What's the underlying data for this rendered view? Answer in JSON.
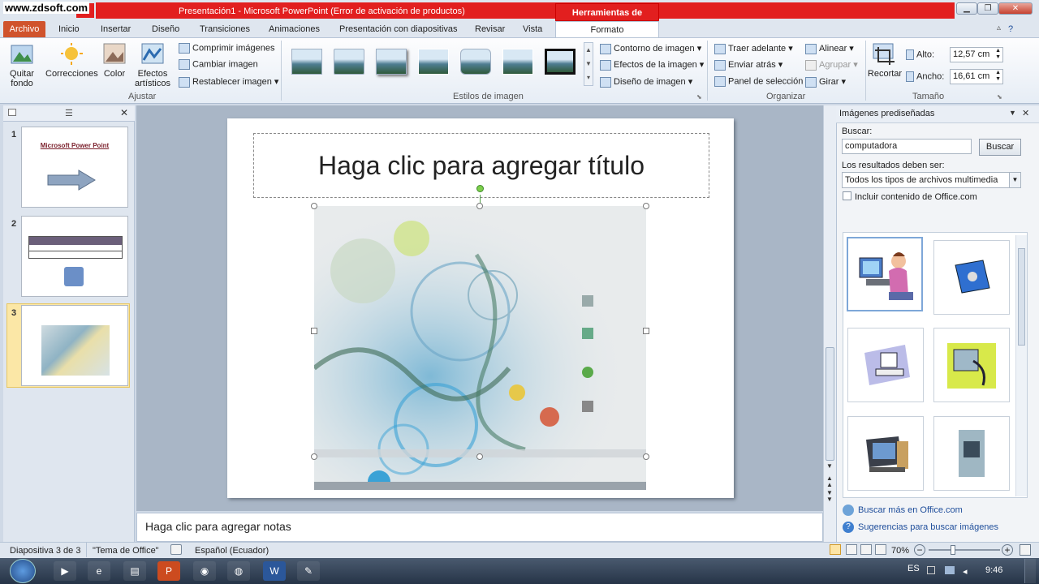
{
  "watermark": "www.zdsoft.com",
  "window": {
    "title": "Presentación1  -  Microsoft PowerPoint (Error de activación de productos)",
    "context_tab": "Herramientas de imagen",
    "minimize": "▁",
    "restore": "❐",
    "close": "✕"
  },
  "tabs": {
    "archivo": "Archivo",
    "items": [
      "Inicio",
      "Insertar",
      "Diseño",
      "Transiciones",
      "Animaciones",
      "Presentación con diapositivas",
      "Revisar",
      "Vista"
    ],
    "formato": "Formato"
  },
  "ribbon": {
    "ajustar": {
      "label": "Ajustar",
      "quitar_fondo": "Quitar fondo",
      "correcciones": "Correcciones",
      "color": "Color",
      "efectos_artisticos": "Efectos artísticos",
      "comprimir": "Comprimir imágenes",
      "cambiar": "Cambiar imagen",
      "restablecer": "Restablecer imagen"
    },
    "estilos": {
      "label": "Estilos de imagen",
      "contorno": "Contorno de imagen",
      "efectos": "Efectos de la imagen",
      "diseno": "Diseño de imagen"
    },
    "organizar": {
      "label": "Organizar",
      "traer": "Traer adelante",
      "enviar": "Enviar atrás",
      "panel": "Panel de selección",
      "alinear": "Alinear",
      "agrupar": "Agrupar",
      "girar": "Girar"
    },
    "tamano": {
      "label": "Tamaño",
      "recortar": "Recortar",
      "alto_label": "Alto:",
      "alto_value": "12,57 cm",
      "ancho_label": "Ancho:",
      "ancho_value": "16,61 cm"
    }
  },
  "slides": [
    {
      "num": "1",
      "title": "Microsoft  Power  Point"
    },
    {
      "num": "2"
    },
    {
      "num": "3"
    }
  ],
  "slide": {
    "title_placeholder": "Haga clic para agregar título"
  },
  "notes_placeholder": "Haga clic para agregar notas",
  "clipart_pane": {
    "title": "Imágenes prediseñadas",
    "buscar_label": "Buscar:",
    "search_value": "computadora",
    "search_button": "Buscar",
    "results_label": "Los resultados deben ser:",
    "type_value": "Todos los tipos de archivos multimedia",
    "include_office": "Incluir contenido de Office.com",
    "link_more": "Buscar más en Office.com",
    "link_tips": "Sugerencias para buscar imágenes"
  },
  "status": {
    "slide_info": "Diapositiva 3 de 3",
    "theme": "\"Tema de Office\"",
    "language": "Español (Ecuador)",
    "zoom": "70%"
  },
  "taskbar": {
    "lang": "ES",
    "time": "9:46"
  }
}
